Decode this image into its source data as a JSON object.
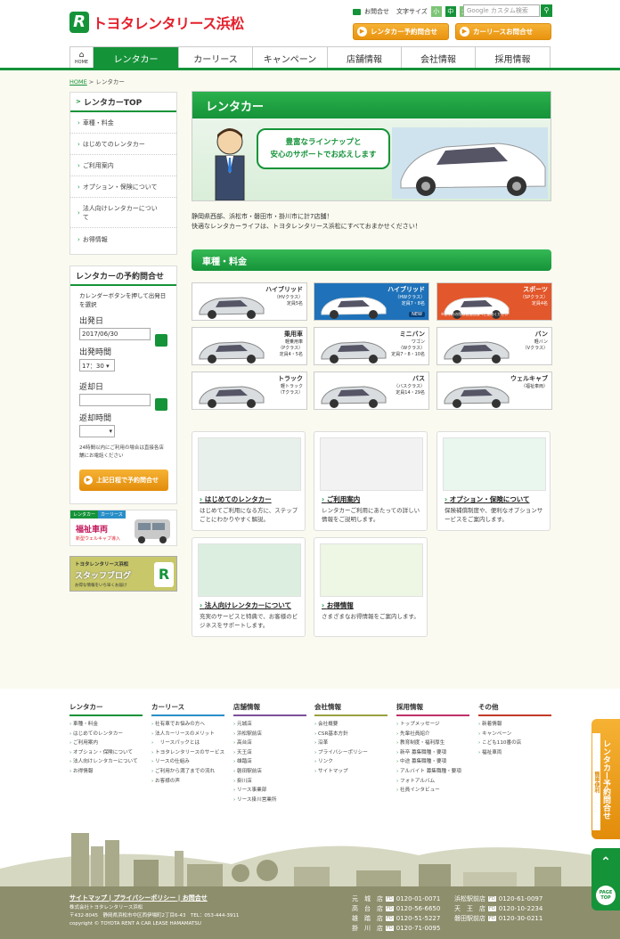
{
  "header": {
    "logo_text": "トヨタレンタリース浜松",
    "contact": "お問合せ",
    "font_size_label": "文字サイズ",
    "font_sizes": [
      "小",
      "中",
      "大"
    ],
    "search_placeholder": "Google カスタム検索",
    "rental_btn": "レンタカー予約問合せ",
    "lease_btn": "カーリースお問合せ"
  },
  "nav": {
    "home": "HOME",
    "items": [
      "レンタカー",
      "カーリース",
      "キャンペーン",
      "店舗情報",
      "会社情報",
      "採用情報"
    ]
  },
  "breadcrumb": {
    "home": "HOME",
    "current": "レンタカー"
  },
  "sidebar": {
    "title": "レンタカーTOP",
    "menu": [
      "車種・料金",
      "はじめてのレンタカー",
      "ご利用案内",
      "オプション・保険について",
      "法人向けレンタカーについて",
      "お得情報"
    ],
    "reserve_title": "レンタカーの予約問合せ",
    "reserve_note": "カレンダーボタンを押して出発日を選択",
    "depart_date_label": "出発日",
    "depart_date": "2017/06/30",
    "depart_time_label": "出発時間",
    "depart_time": "17：30",
    "return_date_label": "返却日",
    "return_time_label": "返却時間",
    "notice": "24時間以内にご利用の場合は直接各店舗にお電話ください",
    "notice_link": "各店舗",
    "submit": "上記日程で予約問合せ",
    "banner1_tag1": "レンタカー",
    "banner1_tag2": "カーリース",
    "banner1_title": "福祉車両",
    "banner1_sub": "新型ウェルキャブ導入",
    "banner2_title": "トヨタレンタリース浜松",
    "banner2_sub": "スタッフブログ",
    "banner2_note": "お得な情報をいち早くお届け"
  },
  "banner": {
    "title": "レンタカー",
    "bubble1": "豊富なラインナップと",
    "bubble2": "安心のサポートでお応えします"
  },
  "intro": {
    "line1": "静岡県西部、浜松市・磐田市・掛川市に計7店舗！",
    "line2": "快適なレンタカーライフは、トヨタレンタリース浜松にすべておまかせください！"
  },
  "category": {
    "title": "車種・料金",
    "tiles": [
      {
        "name": "ハイブリッド",
        "sub": "（HVクラス）",
        "cap": "定員5名",
        "style": "white"
      },
      {
        "name": "ハイブリッド",
        "sub": "（HWクラス）",
        "cap": "定員7・8名",
        "badge": "NEW",
        "style": "blue"
      },
      {
        "name": "スポーツ",
        "sub": "（SPクラス）",
        "cap": "定員4名",
        "note": "※ご予約の際は直接店舗へご連絡ください",
        "style": "red"
      },
      {
        "name": "乗用車",
        "sub": "軽乗用車",
        "sub2": "（Pクラス）",
        "cap": "定員4・5名",
        "style": "white"
      },
      {
        "name": "ミニバン",
        "sub": "ワゴン",
        "sub2": "（Wクラス）",
        "cap": "定員7・8・10名",
        "style": "white"
      },
      {
        "name": "バン",
        "sub": "軽バン",
        "sub2": "（Vクラス）",
        "cap": "",
        "style": "white"
      },
      {
        "name": "トラック",
        "sub": "軽トラック",
        "sub2": "（Tクラス）",
        "cap": "",
        "style": "white"
      },
      {
        "name": "バス",
        "sub": "（バスクラス）",
        "cap": "定員14・29名",
        "style": "white"
      },
      {
        "name": "ウェルキャブ",
        "sub": "（福祉車両）",
        "cap": "",
        "style": "white"
      }
    ]
  },
  "features": [
    {
      "title": "はじめてのレンタカー",
      "desc": "はじめてご利用になる方に、ステップごとにわかりやすく解説。"
    },
    {
      "title": "ご利用案内",
      "desc": "レンタカーご利用にあたっての詳しい情報をご説明します。"
    },
    {
      "title": "オプション・保険について",
      "desc": "保険補償制度や、便利なオプションサービスをご案内します。"
    },
    {
      "title": "法人向けレンタカーについて",
      "desc": "充実のサービスと特典で、お客様のビジネスをサポートします。"
    },
    {
      "title": "お得情報",
      "desc": "さまざまなお得情報をご案内します。"
    }
  ],
  "footer": {
    "cols": [
      {
        "title": "レンタカー",
        "color": "#159339",
        "links": [
          "車種・料金",
          "はじめてのレンタカー",
          "ご利用案内",
          "オプション・保険について",
          "法人向けレンタカーについて",
          "お得情報"
        ]
      },
      {
        "title": "カーリース",
        "color": "#2a8fc8",
        "links": [
          "社有車でお悩みの方へ",
          "法人カーリースのメリット",
          "　リースパックとは",
          "トヨタレンタリースのサービス",
          "リースの仕組み",
          "ご利用から満了までの流れ",
          "お客様の声"
        ]
      },
      {
        "title": "店舗情報",
        "color": "#7d4f9b",
        "links": [
          "元城店",
          "浜松駅前店",
          "高台店",
          "天王店",
          "雄踏店",
          "磐田駅前店",
          "掛川店",
          "リース事業部",
          "リース掛川営業所"
        ]
      },
      {
        "title": "会社情報",
        "color": "#9aa040",
        "links": [
          "会社概要",
          "CSR基本方針",
          "沿革",
          "プライバシーポリシー",
          "リンク",
          "サイトマップ"
        ]
      },
      {
        "title": "採用情報",
        "color": "#c0306a",
        "links": [
          "トップメッセージ",
          "先輩社員紹介",
          "教育制度・福利厚生",
          "新卒 募集職種・要項",
          "中途 募集職種・要項",
          "アルバイト 募集職種・要項",
          "フォトアルバム",
          "社員インタビュー"
        ]
      },
      {
        "title": "その他",
        "color": "#c23a2a",
        "links": [
          "新着情報",
          "キャンペーン",
          "こども110番の店",
          "福祉車両"
        ]
      }
    ],
    "links": [
      "サイトマップ",
      "プライバシーポリシー",
      "お問合せ"
    ],
    "company": "株式会社トヨタレンタリース浜松",
    "address": "〒432-8045　静岡県浜松市中区西伊場町2丁目6-43　TEL：053-444-3911",
    "copyright": "copyright © TOYOTA RENT A CAR LEASE HAMAMATSU",
    "branches": [
      {
        "name": "元　城　店",
        "tel": "0120-01-0071"
      },
      {
        "name": "浜松駅前店",
        "tel": "0120-61-0097"
      },
      {
        "name": "高　台　店",
        "tel": "0120-56-6650"
      },
      {
        "name": "天　王　店",
        "tel": "0120-10-2234"
      },
      {
        "name": "雄　踏　店",
        "tel": "0120-51-5227"
      },
      {
        "name": "磐田駅前店",
        "tel": "0120-30-0211"
      },
      {
        "name": "掛　川　店",
        "tel": "0120-71-0095"
      }
    ],
    "freedial": "FD"
  },
  "floating": {
    "reserve_tab": "レンタカー予約問合せ",
    "reserve_sub": "簡単便利",
    "page_top": "PAGE TOP"
  }
}
